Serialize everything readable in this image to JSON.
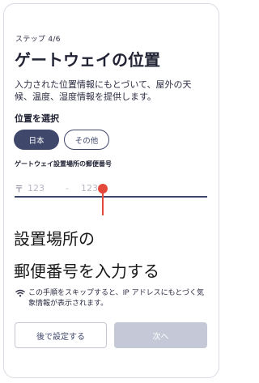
{
  "header": {
    "step": "ステップ 4/6",
    "title": "ゲートウェイの位置"
  },
  "description": "入力された位置情報にもとづいて、屋外の天候、温度、湿度情報を提供します。",
  "location": {
    "section_label": "位置を選択",
    "options": [
      {
        "label": "日本",
        "selected": true
      },
      {
        "label": "その他",
        "selected": false
      }
    ]
  },
  "postal": {
    "label": "ゲートウェイ設置場所の郵便番号",
    "symbol": "〒",
    "placeholder_first": "123",
    "separator": "-",
    "placeholder_second": "1234"
  },
  "annotation": {
    "line1": "設置場所の",
    "line2": "郵便番号を入力する",
    "color": "#e4483a"
  },
  "notice": {
    "icon": "wifi-icon",
    "text": "この手順をスキップすると、IP アドレスにもとづく気象情報が表示されます。"
  },
  "buttons": {
    "later": "後で設定する",
    "next": "次へ",
    "next_disabled": true
  },
  "colors": {
    "primary": "#3f476b",
    "disabled": "#c5c8d6",
    "accent": "#e4483a"
  }
}
